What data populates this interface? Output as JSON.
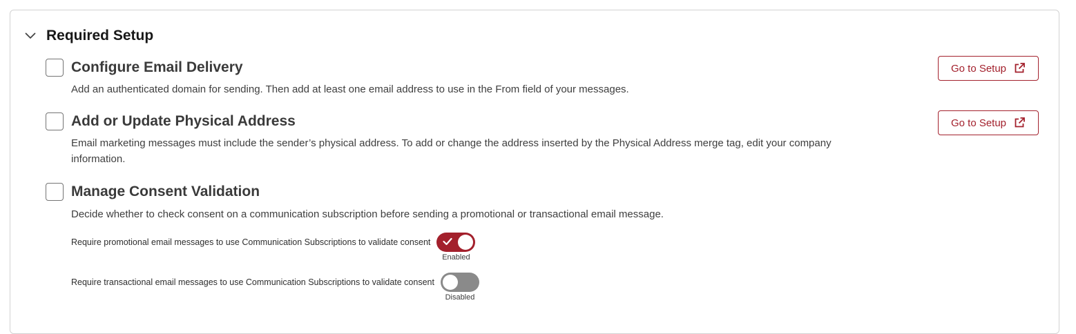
{
  "section": {
    "title": "Required Setup",
    "chevron_icon": "chevron-down-icon"
  },
  "items": [
    {
      "title": "Configure Email Delivery",
      "description": "Add an authenticated domain for sending. Then add at least one email address to use in the From field of your messages.",
      "checked": false,
      "button_label": "Go to Setup",
      "button_icon": "external-link-icon"
    },
    {
      "title": "Add or Update Physical Address",
      "description": "Email marketing messages must include the sender’s physical address. To add or change the address inserted by the Physical Address merge tag, edit your company information.",
      "checked": false,
      "button_label": "Go to Setup",
      "button_icon": "external-link-icon"
    },
    {
      "title": "Manage Consent Validation",
      "description": "Decide whether to check consent on a communication subscription before sending a promotional or transactional email message.",
      "checked": false
    }
  ],
  "toggles": [
    {
      "label": "Require promotional email messages to use Communication Subscriptions to validate consent",
      "state": "Enabled",
      "on": true
    },
    {
      "label": "Require transactional email messages to use Communication Subscriptions to validate consent",
      "state": "Disabled",
      "on": false
    }
  ],
  "colors": {
    "accent": "#a3202c",
    "toggle_off": "#8a8a8a",
    "border": "#d2d2d2"
  }
}
